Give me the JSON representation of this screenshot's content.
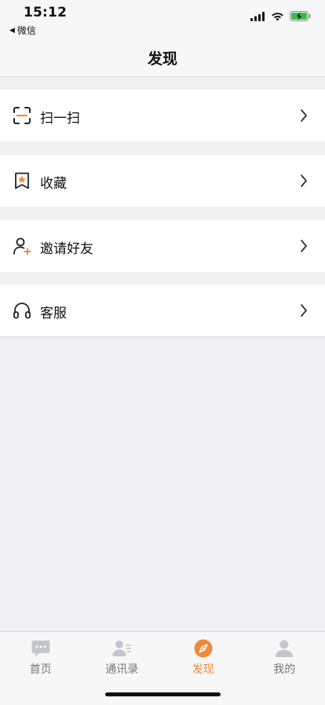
{
  "status": {
    "time": "15:12",
    "back_app": "微信"
  },
  "header": {
    "title": "发现"
  },
  "menu": {
    "items": [
      {
        "label": "扫一扫",
        "icon": "scan-icon"
      },
      {
        "label": "收藏",
        "icon": "bookmark-star-icon"
      },
      {
        "label": "邀请好友",
        "icon": "add-friend-icon"
      },
      {
        "label": "客服",
        "icon": "headset-icon"
      }
    ]
  },
  "tabbar": {
    "tabs": [
      {
        "label": "首页",
        "icon": "chat-bubble-icon"
      },
      {
        "label": "通讯录",
        "icon": "contacts-icon"
      },
      {
        "label": "发现",
        "icon": "compass-icon",
        "active": true
      },
      {
        "label": "我的",
        "icon": "person-icon"
      }
    ]
  },
  "colors": {
    "accent": "#ef8a3b",
    "background": "#f1f1f4",
    "inactive": "#c5c5cc"
  }
}
